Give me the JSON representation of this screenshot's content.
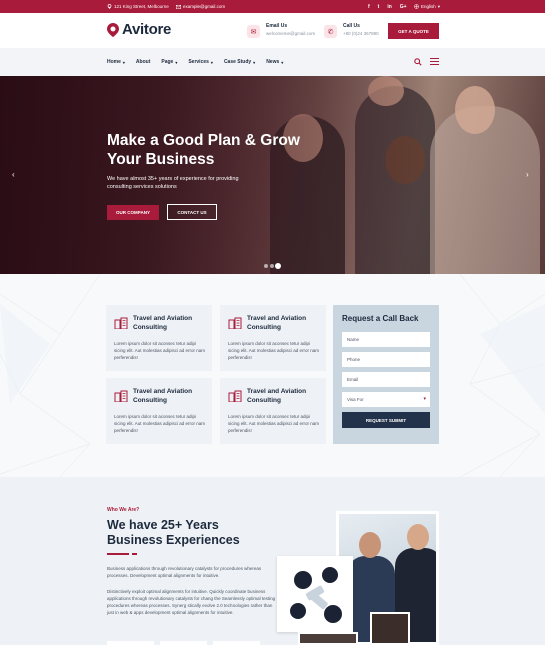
{
  "topbar": {
    "location": "121 King Street, Melbourne",
    "email": "example@gmail.com",
    "social": [
      "f",
      "t",
      "in",
      "G+"
    ],
    "language": "English"
  },
  "header": {
    "brand": "Avitore",
    "email_label": "Email Us",
    "email_value": "welcomeme@gmail.com",
    "call_label": "Call Us",
    "call_value": "+80 (0)24 367890",
    "quote_button": "GET A QUOTE"
  },
  "nav": {
    "items": [
      {
        "label": "Home",
        "dropdown": true
      },
      {
        "label": "About",
        "dropdown": false
      },
      {
        "label": "Page",
        "dropdown": true
      },
      {
        "label": "Services",
        "dropdown": true
      },
      {
        "label": "Case Study",
        "dropdown": true
      },
      {
        "label": "News",
        "dropdown": true
      }
    ]
  },
  "hero": {
    "title": "Make a Good Plan & Grow Your Business",
    "subtitle": "We have almost 35+ years of experience for providing consulting services solutions",
    "primary_button": "OUR COMPANY",
    "secondary_button": "CONTACT US"
  },
  "services": {
    "cards": [
      {
        "title": "Travel and Aviation Consulting",
        "text": "Lorem ipsum dolor sit aconsec tetur adipi sicing elit. Aut molestias adipisci ad error nam perferendis!"
      },
      {
        "title": "Travel and Aviation Consulting",
        "text": "Lorem ipsum dolor sit aconsec tetur adipi sicing elit. Aut molestias adipisci ad error nam perferendis!"
      },
      {
        "title": "Travel and Aviation Consulting",
        "text": "Lorem ipsum dolor sit aconsec tetur adipi sicing elit. Aut molestias adipisci ad error nam perferendis!"
      },
      {
        "title": "Travel and Aviation Consulting",
        "text": "Lorem ipsum dolor sit aconsec tetur adipi sicing elit. Aut molestias adipisci ad error nam perferendis!"
      }
    ]
  },
  "callback": {
    "title": "Request a Call Back",
    "name_placeholder": "Name",
    "phone_placeholder": "Phone",
    "email_placeholder": "Email",
    "visa_select": "Visa For",
    "submit": "REQUEST SUBMIT"
  },
  "about": {
    "kicker": "Who We Are?",
    "title": "We have 25+ Years Business Experiences",
    "paragraph1": "Business applications through revolutionary catalysts for procedures whereas processes. Development optimal alignments for intuitive.",
    "paragraph2": "Distinctively exploit optimal alignments for intuitive. Quickly coordinate business applications through revolutionary catalysts for chang the Seamlessly optimal testing procedures whereas processes. Synerg stically evolve 2.0 technologies rather than just in web & apps development optimal alignments for intuitive."
  },
  "colors": {
    "brand": "#a81b3a",
    "dark": "#1d2a3d"
  }
}
